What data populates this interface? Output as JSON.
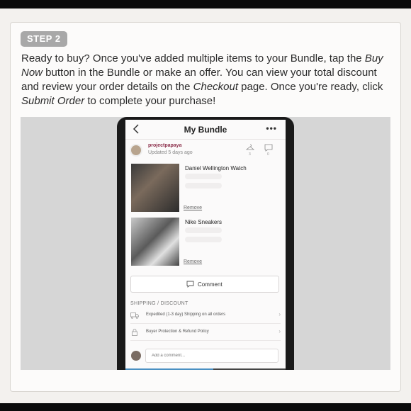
{
  "step": {
    "badge": "STEP 2"
  },
  "instructions": {
    "p1": "Ready to buy? Once you've added multiple items to your Bundle, tap the ",
    "e1": "Buy Now",
    "p2": " button in the Bundle or make an offer. You can view your total discount and review your order details on the ",
    "e2": "Checkout",
    "p3": " page. Once you're ready, click ",
    "e3": "Submit Order",
    "p4": " to complete your purchase!"
  },
  "app": {
    "title": "My Bundle",
    "more": "•••",
    "seller": {
      "name": "projectpapaya",
      "updated": "Updated 5 days ago",
      "likes": "3",
      "comments": "0"
    },
    "items": [
      {
        "title": "Daniel Wellington Watch",
        "remove": "Remove"
      },
      {
        "title": "Nike Sneakers",
        "remove": "Remove"
      }
    ],
    "comment_button": "Comment",
    "section_label": "SHIPPING / DISCOUNT",
    "rows": [
      {
        "text": "Expedited (1-3 day) Shipping on all orders",
        "icon": "truck-icon"
      },
      {
        "text": "Buyer Protection & Refund Policy",
        "icon": "lock-icon"
      }
    ],
    "composer_placeholder": "Add a comment..."
  },
  "progress": {
    "fraction": 0.55
  },
  "colors": {
    "accent_name": "#8b2d49",
    "badge": "#a8a8a8",
    "progress": "#4a90c2"
  }
}
